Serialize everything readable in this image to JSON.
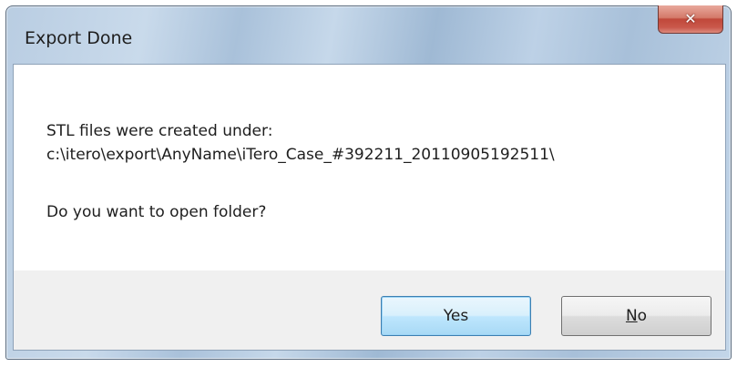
{
  "window": {
    "title": "Export Done",
    "close_icon": "close-icon"
  },
  "message": {
    "line1": "STL files were created under:",
    "line2": "c:\\itero\\export\\AnyName\\iTero_Case_#392211_20110905192511\\",
    "line3": "Do you want to open folder?"
  },
  "buttons": {
    "yes_label": "Yes",
    "no_mnemonic": "N",
    "no_rest": "o"
  },
  "colors": {
    "title_bar": "#bcd0e5",
    "close_button": "#c9584b",
    "button_bar": "#f0f0f0",
    "default_button": "#bee6fd"
  }
}
